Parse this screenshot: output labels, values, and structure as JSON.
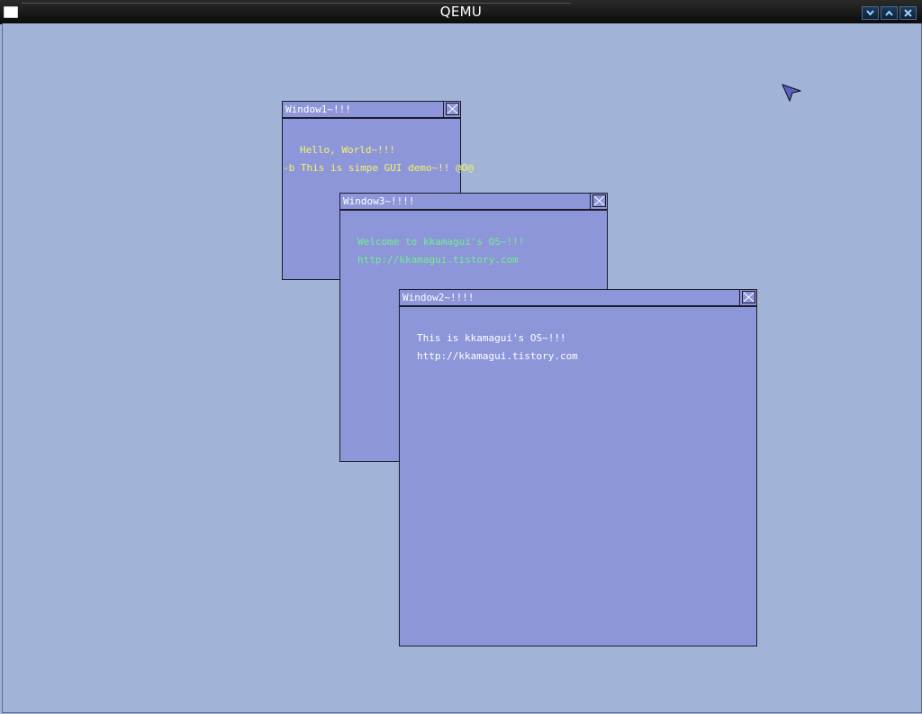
{
  "host": {
    "title": "QEMU"
  },
  "windows": {
    "window1": {
      "title": "Window1~!!!",
      "lines": [
        "Hello, World~!!!",
        "-b This is simpe GUI demo~!! @O@"
      ]
    },
    "window3": {
      "title": "Window3~!!!!",
      "lines": [
        "Welcome to kkamagui's OS~!!!",
        "http://kkamagui.tistory.com"
      ]
    },
    "window2": {
      "title": "Window2~!!!!",
      "lines": [
        "This is kkamagui's OS~!!!",
        "http://kkamagui.tistory.com"
      ]
    }
  },
  "colors": {
    "desktop": "#a1b3d7",
    "window_body": "#8e96da",
    "window1_text": "#f6f26a",
    "window3_text": "#6ef08a",
    "window2_text": "#ffffff"
  },
  "icons": [
    "window-menu-icon",
    "minimize-icon",
    "maximize-icon",
    "close-icon",
    "mouse-cursor-icon"
  ]
}
